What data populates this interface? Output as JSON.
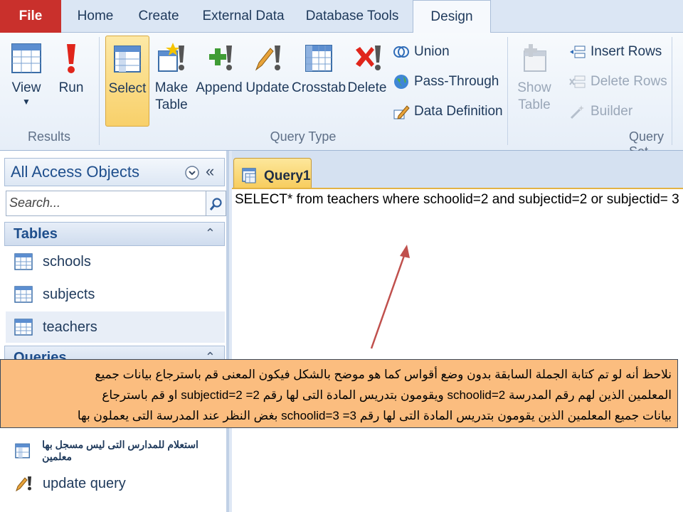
{
  "tabs": [
    "File",
    "Home",
    "Create",
    "External Data",
    "Database Tools",
    "Design"
  ],
  "ribbon": {
    "results": {
      "label": "Results",
      "view": "View",
      "run": "Run"
    },
    "query_type": {
      "label": "Query Type",
      "select": "Select",
      "make_table_1": "Make",
      "make_table_2": "Table",
      "append": "Append",
      "update": "Update",
      "crosstab": "Crosstab",
      "delete": "Delete",
      "union": "Union",
      "pass_through": "Pass-Through",
      "data_definition": "Data Definition"
    },
    "query_setup": {
      "label": "Query Set",
      "show_table_1": "Show",
      "show_table_2": "Table",
      "insert_rows": "Insert Rows",
      "delete_rows": "Delete Rows",
      "builder": "Builder"
    }
  },
  "nav": {
    "title": "All Access Objects",
    "search_placeholder": "Search...",
    "tables_label": "Tables",
    "tables": [
      "schools",
      "subjects",
      "teachers"
    ],
    "queries_label": "Queries",
    "queries": [
      "استعلام للمدارس التى ليس مسجل بها معلمين",
      "update query"
    ]
  },
  "document": {
    "tab_label": "Query1",
    "sql": "SELECT* from teachers where schoolid=2 and subjectid=2 or subjectid= 3"
  },
  "note": {
    "line1": "نلاحظ أنه لو تم كتابة الجملة السابقة بدون وضع أقواس كما هو موضح بالشكل فيكون المعنى قم باسترجاع بيانات جميع",
    "line2": "المعلمين الذين لهم رقم المدرسة schoolid=2 ويقومون بتدريس المادة التى لها رقم 2= subjectid=2 او قم باسترجاع",
    "line3": "بيانات جميع المعلمين الذين يقومون بتدريس المادة التى لها رقم 3= schoolid=3 بغض النظر عند المدرسة التى يعملون بها"
  },
  "colors": {
    "file_tab": "#c9302c",
    "callout": "#fbbd7f",
    "selected": "#f8d06a",
    "arrow": "#c0504d"
  }
}
